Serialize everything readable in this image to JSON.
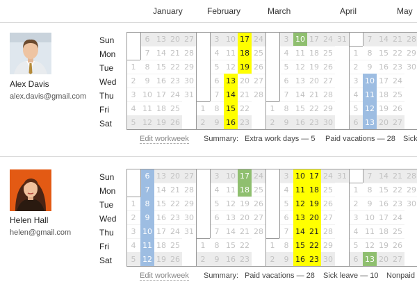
{
  "months": [
    "January",
    "February",
    "March",
    "April",
    "May"
  ],
  "day_names": [
    "Sun",
    "Mon",
    "Tue",
    "Wed",
    "Thu",
    "Fri",
    "Sat"
  ],
  "edit_label": "Edit workweek",
  "summary_label": "Summary:",
  "colors": {
    "highlight_yellow": "#ffff00",
    "highlight_green": "#8fbf6f",
    "highlight_blue": "#9dbde2",
    "weekend": "#ececec",
    "box_border": "#999999"
  },
  "people": [
    {
      "name": "Alex Davis",
      "email": "alex.davis@gmail.com",
      "avatar": "male-portrait",
      "summary": [
        "Extra work days — 5",
        "Paid vacations — 28",
        "Sick"
      ],
      "months": [
        {
          "label": "January",
          "first_weekday": 2,
          "days": 31,
          "highlights": {
            "yellow": [],
            "green": [],
            "blue": []
          }
        },
        {
          "label": "February",
          "first_weekday": 5,
          "days": 28,
          "highlights": {
            "yellow": [
              13,
              14,
              15,
              16,
              17,
              18,
              19
            ],
            "green": [],
            "blue": []
          }
        },
        {
          "label": "March",
          "first_weekday": 5,
          "days": 31,
          "highlights": {
            "yellow": [],
            "green": [
              10
            ],
            "blue": []
          }
        },
        {
          "label": "April",
          "first_weekday": 1,
          "days": 30,
          "highlights": {
            "yellow": [],
            "green": [],
            "blue": [
              10,
              11,
              12,
              13
            ]
          }
        },
        {
          "label": "May",
          "first_weekday": 3,
          "days": 31,
          "highlights": {
            "yellow": [],
            "green": [],
            "blue": []
          }
        }
      ]
    },
    {
      "name": "Helen Hall",
      "email": "helen@gmail.com",
      "avatar": "female-portrait",
      "summary": [
        "Paid vacations — 28",
        "Sick leave — 10",
        "Nonpaid"
      ],
      "months": [
        {
          "label": "January",
          "first_weekday": 2,
          "days": 31,
          "highlights": {
            "yellow": [],
            "green": [],
            "blue": [
              6,
              7,
              8,
              9,
              10,
              11,
              12
            ]
          }
        },
        {
          "label": "February",
          "first_weekday": 5,
          "days": 28,
          "highlights": {
            "yellow": [],
            "green": [
              17,
              18
            ],
            "blue": []
          }
        },
        {
          "label": "March",
          "first_weekday": 5,
          "days": 31,
          "highlights": {
            "yellow": [
              10,
              11,
              12,
              13,
              14,
              15,
              16,
              17,
              18,
              19,
              20,
              21,
              22,
              23
            ],
            "green": [],
            "blue": []
          }
        },
        {
          "label": "April",
          "first_weekday": 1,
          "days": 30,
          "highlights": {
            "yellow": [],
            "green": [
              13
            ],
            "blue": []
          }
        },
        {
          "label": "May",
          "first_weekday": 3,
          "days": 31,
          "highlights": {
            "yellow": [],
            "green": [],
            "blue": []
          }
        }
      ]
    }
  ]
}
